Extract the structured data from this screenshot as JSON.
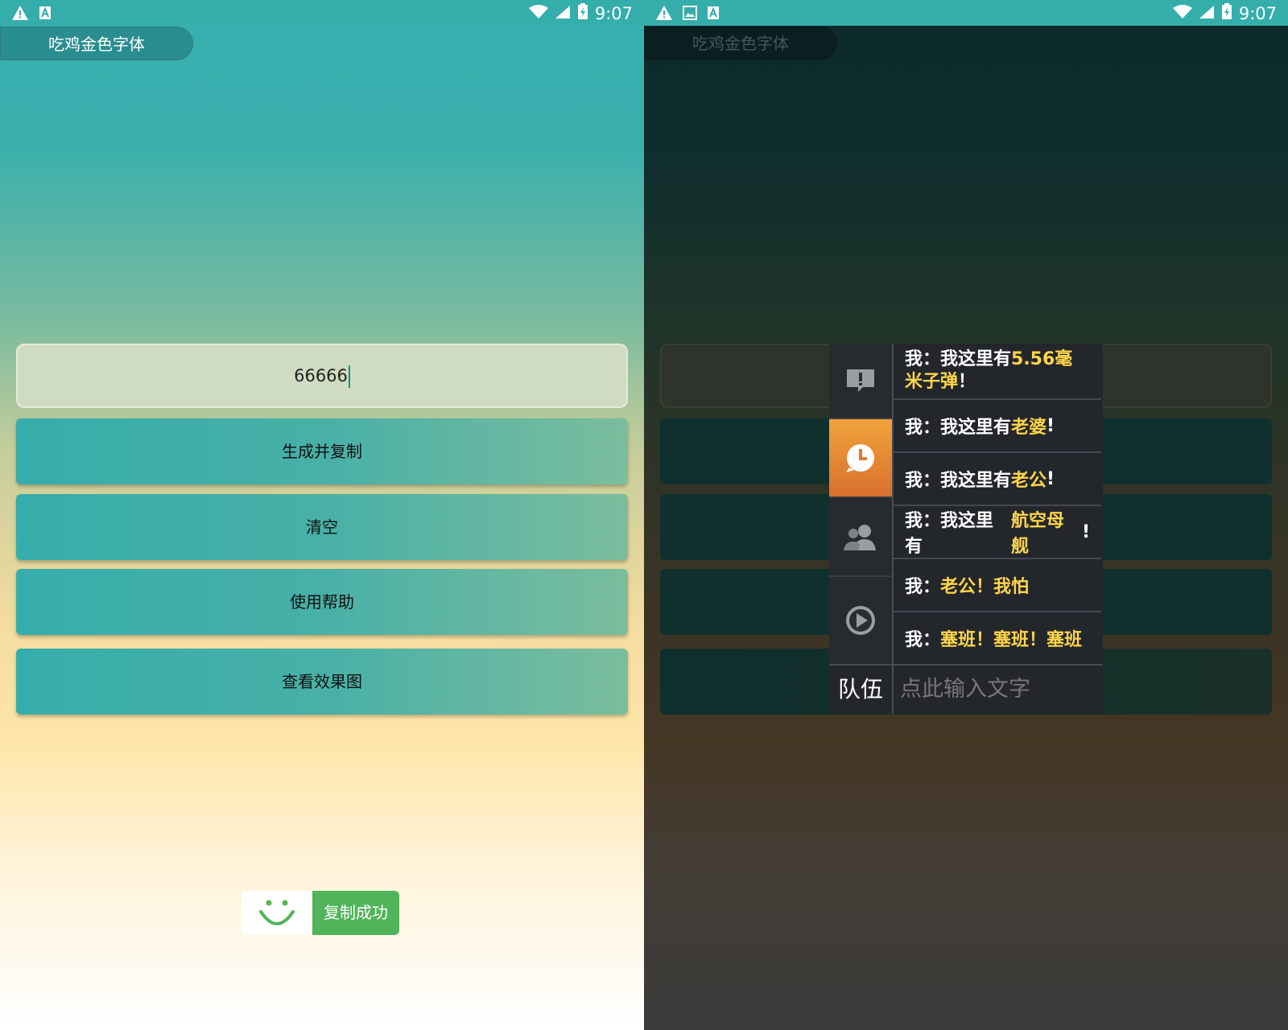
{
  "status_bar": {
    "time": "9:07",
    "left_icons": [
      "warning-icon",
      "app-a-icon"
    ],
    "right_left_icons": [
      "warning-icon",
      "image-icon",
      "app-a-icon"
    ],
    "right_icons": [
      "wifi-icon",
      "signal-icon",
      "battery-charging-icon"
    ]
  },
  "left": {
    "app_title": "吃鸡金色字体",
    "input": {
      "value": "66666"
    },
    "buttons": {
      "generate_copy": "生成并复制",
      "clear": "清空",
      "help": "使用帮助",
      "preview": "查看效果图"
    },
    "toast": {
      "message": "复制成功",
      "icon": "smiley-icon"
    }
  },
  "right": {
    "app_title": "吃鸡金色字体",
    "chat": {
      "messages": [
        {
          "prefix": "我：我这里有",
          "highlight": "5.56毫米子弹",
          "suffix": "！"
        },
        {
          "prefix": "我：我这里有",
          "highlight": "老婆",
          "suffix": "!"
        },
        {
          "prefix": "我：我这里有",
          "highlight": "老公",
          "suffix": "!"
        },
        {
          "prefix": "我：我这里有",
          "highlight": "航空母舰",
          "suffix": "!"
        },
        {
          "prefix": "我：",
          "highlight": "老公！我怕",
          "suffix": ""
        },
        {
          "prefix": "我：",
          "highlight": "塞班！塞班！塞班",
          "suffix": ""
        }
      ],
      "side_icons": [
        "alert-icon",
        "clock-icon",
        "team-icon",
        "play-icon"
      ],
      "channel_label": "队伍",
      "input_placeholder": "点此输入文字"
    }
  },
  "colors": {
    "accent": "#36adac",
    "toast_green": "#52b45a",
    "highlight_gold": "#ffd54a",
    "active_tab_orange": "#e9853a"
  }
}
